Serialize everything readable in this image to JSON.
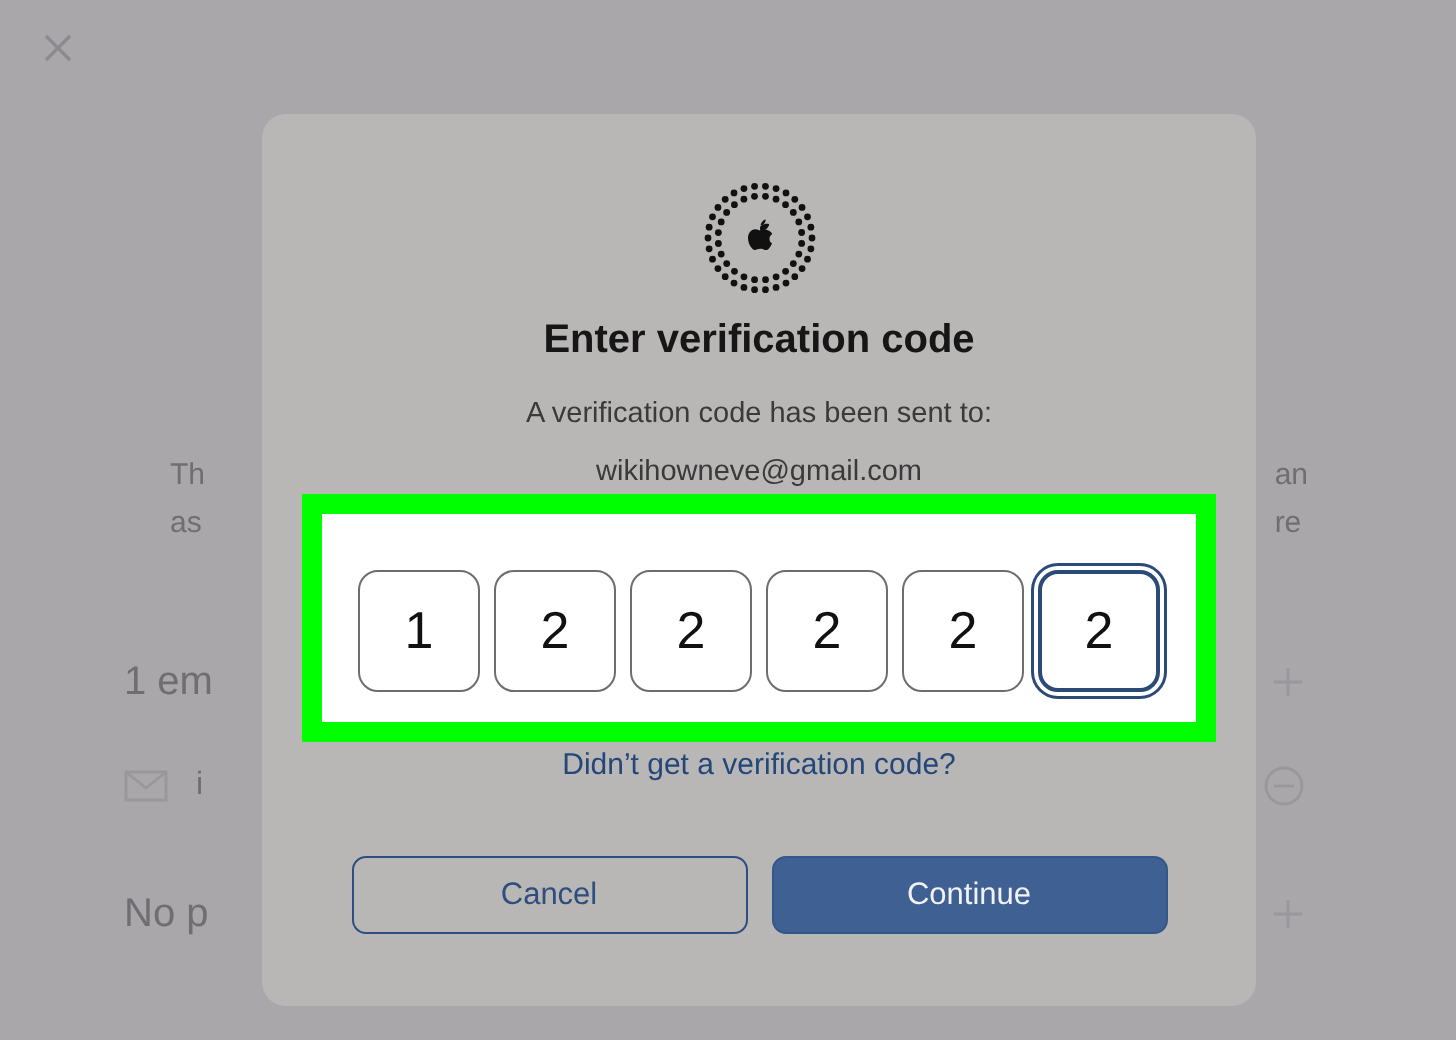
{
  "background": {
    "paragraph_left": [
      "Th",
      "as"
    ],
    "paragraph_right": [
      "an",
      "re"
    ],
    "rows": [
      {
        "kind": "add",
        "label": "1 em"
      },
      {
        "kind": "mail",
        "label": "i"
      },
      {
        "kind": "add",
        "label": "No p"
      }
    ]
  },
  "dialog": {
    "title": "Enter verification code",
    "message": "A verification code has been sent to:",
    "email": "wikihowneve@gmail.com",
    "code_digits": [
      {
        "value": "1",
        "selected": false
      },
      {
        "value": "2",
        "selected": false
      },
      {
        "value": "2",
        "selected": false
      },
      {
        "value": "2",
        "selected": false
      },
      {
        "value": "2",
        "selected": false
      },
      {
        "value": "2",
        "selected": true
      }
    ],
    "resend_link": "Didn’t get a verification code?",
    "buttons": [
      {
        "kind": "secondary",
        "label": "Cancel"
      },
      {
        "kind": "primary",
        "label": "Continue"
      }
    ]
  }
}
